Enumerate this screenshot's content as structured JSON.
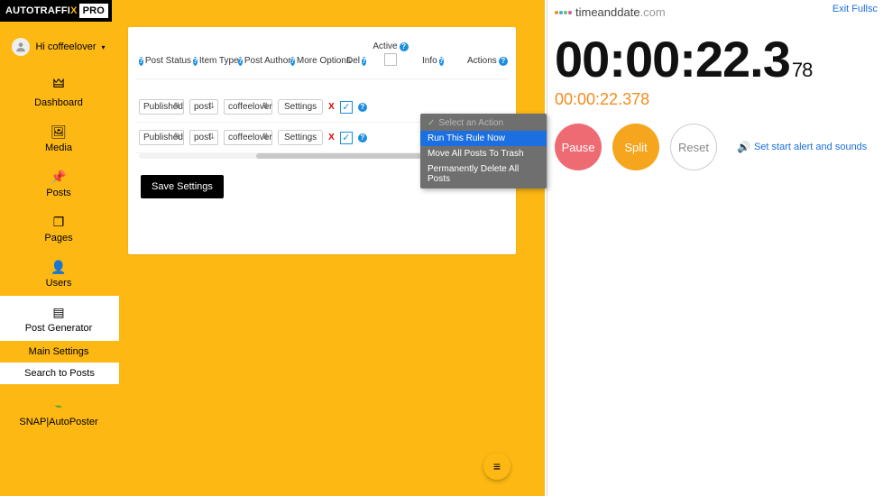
{
  "logo": {
    "brand": "AUTOTRAFFI",
    "x": "X",
    "pro": "PRO"
  },
  "user_greeting": "Hi coffeelover",
  "nav": {
    "dashboard": "Dashboard",
    "media": "Media",
    "posts": "Posts",
    "pages": "Pages",
    "users": "Users",
    "post_generator": "Post Generator",
    "snap": "SNAP|AutoPoster"
  },
  "subnav": {
    "main_settings": "Main Settings",
    "search_to_posts": "Search to Posts"
  },
  "table": {
    "headers": {
      "post_status": "Post Status",
      "item_type": "Item Type",
      "post_author": "Post Author",
      "more_options": "More Options",
      "del": "Del",
      "active": "Active",
      "info": "Info",
      "actions": "Actions"
    },
    "rows": [
      {
        "status": "Published",
        "type": "post",
        "author": "coffeelover",
        "settings_label": "Settings",
        "del": "X",
        "active": true
      },
      {
        "status": "Published",
        "type": "post",
        "author": "coffeelover",
        "settings_label": "Settings",
        "del": "X",
        "active": true
      }
    ]
  },
  "actions_menu": {
    "placeholder": "Select an Action",
    "run": "Run This Rule Now",
    "trash": "Move All Posts To Trash",
    "delete": "Permanently Delete All Posts"
  },
  "save_button": "Save Settings",
  "timeanddate": {
    "site": "timeanddate",
    "tld": ".com",
    "exit": "Exit Fullsc",
    "main": "00:00:22.3",
    "frac": "78",
    "sub": "00:00:22.378",
    "pause": "Pause",
    "split": "Split",
    "reset": "Reset",
    "alert": "Set start alert and sounds"
  }
}
